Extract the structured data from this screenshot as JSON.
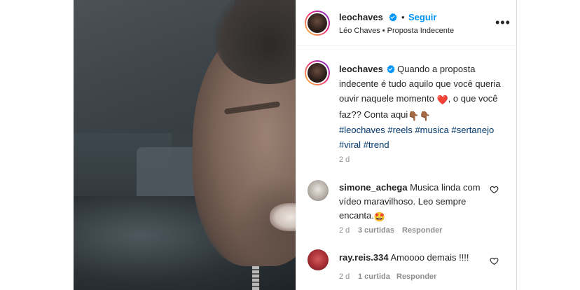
{
  "post": {
    "author": {
      "username": "leochaves",
      "follow_label": "Seguir",
      "dot": "•",
      "subtitle": "Léo Chaves • Proposta Indecente"
    },
    "caption": {
      "username": "leochaves",
      "text_part1": "Quando a proposta indecente é tudo aquilo que você queria ouvir naquele momento ",
      "emoji_heart": "❤️",
      "text_part2": ", o que você faz?? Conta aqui",
      "emoji_hands": "👇🏾👇🏾",
      "hashtags": [
        "#leochaves",
        "#reels",
        "#musica",
        "#sertanejo",
        "#viral",
        "#trend"
      ],
      "age": "2 d"
    },
    "comments": [
      {
        "username": "simone_achega",
        "text": "Musica linda com vídeo maravilhoso. Leo sempre encanta.",
        "emoji": "🤩",
        "age": "2 d",
        "likes": "3 curtidas",
        "reply_label": "Responder"
      },
      {
        "username": "ray.reis.334",
        "text": "Amoooo demais !!!!",
        "age": "2 d",
        "likes": "1 curtida",
        "reply_label": "Responder"
      }
    ]
  },
  "colors": {
    "link_blue": "#0095f6",
    "hashtag_blue": "#00376b",
    "muted": "#8e8e8e",
    "verified": "#0095f6",
    "heart_red": "#ed4956"
  },
  "icons": {
    "verified": "verified-badge-icon",
    "more": "more-options-icon",
    "like": "heart-outline-icon"
  }
}
